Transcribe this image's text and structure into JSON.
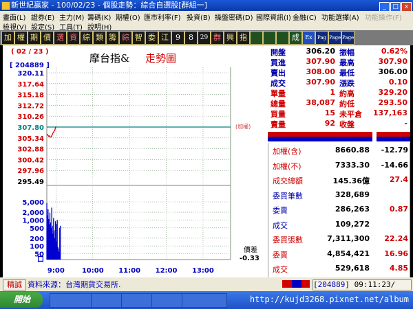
{
  "window": {
    "title": "新世紀贏家 - 100/02/23 - 個股走勢：綜合自選股[群組一]",
    "controls": [
      "_",
      "□",
      "x"
    ]
  },
  "menu": {
    "row1": [
      "畫面(L)",
      "證券(E)",
      "主力(M)",
      "籌碼(K)",
      "期權(O)",
      "匯市利率(F)",
      "投資(B)",
      "操盤密碼(D)",
      "國際資訊(I)",
      "金融(C)",
      "功能選擇(A)",
      "功能操作(F)"
    ],
    "row2": [
      "檢視(V)",
      "設定(S)",
      "工具(T)",
      "說明(H)"
    ]
  },
  "toolbar": {
    "buttons": [
      "加",
      "權",
      "期",
      "價",
      "選",
      "資",
      "綜",
      "類",
      "籌",
      "綜",
      "智",
      "委",
      "江",
      "9",
      "8",
      "29",
      "群",
      "興",
      "指",
      "",
      "",
      "",
      "成",
      "Ex",
      "Pag",
      "Page",
      "Page"
    ]
  },
  "chart": {
    "date_label": "( 02 / 23 )",
    "code_label": "[ 204889 ]",
    "title_black": "摩台指&",
    "title_red": "走勢圖",
    "ref_price": "307.80",
    "ref_price_note": "(加權)",
    "price_ticks": [
      "320.11",
      "317.64",
      "315.18",
      "312.72",
      "310.26",
      "307.80",
      "305.34",
      "302.88",
      "300.42",
      "297.96",
      "295.49"
    ],
    "volume_ticks": [
      "5,000",
      "2,000",
      "1,000",
      "500",
      "200",
      "100",
      "50",
      "口"
    ],
    "time_ticks": [
      "9:00",
      "10:00",
      "11:00",
      "12:00",
      "13:00"
    ],
    "diff_label": "價差",
    "diff_value": "-0.33",
    "colors": {
      "price_line": "#d00000",
      "ref_line": "#008080",
      "volume": "#0000d0",
      "grid": "#7a9a7a"
    }
  },
  "chart_data": {
    "type": "line",
    "x": [
      "08:45",
      "08:46",
      "08:47",
      "08:48",
      "08:49",
      "08:50",
      "08:51",
      "08:52",
      "08:53",
      "08:54",
      "08:55",
      "08:56",
      "08:57",
      "08:58",
      "08:59",
      "09:00"
    ],
    "series": [
      {
        "values": [
          306.2,
          306.1,
          305.9,
          305.7,
          305.8,
          305.6,
          305.5,
          305.6,
          305.8,
          306.1,
          306.4,
          306.6,
          306.9,
          307.0,
          307.6,
          307.9
        ]
      }
    ],
    "volume_x": [
      "08:45",
      "08:46",
      "08:47",
      "08:48",
      "08:49",
      "08:50",
      "08:51",
      "08:52",
      "08:53",
      "08:54",
      "08:55",
      "08:56",
      "08:57",
      "08:58",
      "08:59",
      "09:00",
      "09:01",
      "09:02",
      "09:03",
      "09:04",
      "09:05",
      "09:06",
      "09:07"
    ],
    "volume": [
      4500,
      1500,
      2600,
      1100,
      700,
      1900,
      800,
      500,
      3000,
      600,
      300,
      1200,
      400,
      200,
      900,
      150,
      700,
      1000,
      90,
      80,
      60,
      500,
      600
    ],
    "ylim": [
      295.49,
      320.11
    ],
    "volume_scale": "log",
    "volume_ylim": [
      50,
      5000
    ],
    "x_range": [
      "08:45",
      "13:45"
    ],
    "grid": true
  },
  "quote": {
    "rows": [
      {
        "l1": "開盤",
        "v1": "306.20",
        "l2": "振幅",
        "v2": "0.62%",
        "c1": "#000000",
        "c2": "#d00000"
      },
      {
        "l1": "買進",
        "v1": "307.90",
        "l2": "最高",
        "v2": "307.90",
        "c1": "#d00000",
        "c2": "#d00000"
      },
      {
        "l1": "賣出",
        "v1": "308.00",
        "l2": "最低",
        "v2": "306.00",
        "c1": "#d00000",
        "c2": "#000000"
      },
      {
        "l1": "成交",
        "v1": "307.90",
        "l2": "漲跌",
        "v2": "0.10",
        "c1": "#d00000",
        "c2": "#d00000"
      },
      {
        "l1": "單量",
        "v1": "1",
        "l2": "約高",
        "v2": "329.20",
        "c1": "#d00000",
        "c2": "#d00000",
        "lc1": "red",
        "lc2": "red"
      },
      {
        "l1": "總量",
        "v1": "38,087",
        "l2": "約低",
        "v2": "293.50",
        "c1": "#d00000",
        "c2": "#d00000",
        "lc1": "red",
        "lc2": "red"
      },
      {
        "l1": "買量",
        "v1": "15",
        "l2": "未平倉",
        "v2": "137,163",
        "c1": "#d00000",
        "c2": "#d00000",
        "lc1": "red",
        "lc2": "red"
      },
      {
        "l1": "賣量",
        "v1": "92",
        "l2": "收盤",
        "v2": "-",
        "c1": "#d00000",
        "c2": "#d00000",
        "lc1": "red",
        "lc2": "red"
      }
    ]
  },
  "index_info": {
    "rows": [
      {
        "label": "加權(含)",
        "v1": "8660.88",
        "v2": "-12.79",
        "lc": "#d00000",
        "c2": "#000000"
      },
      {
        "label": "加權(不)",
        "v1": "7333.30",
        "v2": "-14.66",
        "lc": "#d00000",
        "c2": "#000000"
      },
      {
        "label": "成交總額",
        "v1": "145.36億",
        "v2": "27.4",
        "lc": "#d00000",
        "c2": "#d00000"
      },
      {
        "label": "委買筆數",
        "v1": "328,689",
        "v2": "",
        "lc": "#0000b0",
        "c2": "#000000"
      },
      {
        "label": "委賣",
        "v1": "286,263",
        "v2": "0.87",
        "lc": "#0000b0",
        "c2": "#d00000"
      },
      {
        "label": "成交",
        "v1": "109,272",
        "v2": "",
        "lc": "#0000b0",
        "c2": "#000000"
      },
      {
        "label": "委買張數",
        "v1": "7,311,300",
        "v2": "22.24",
        "lc": "#d00000",
        "c2": "#d00000"
      },
      {
        "label": "委賣",
        "v1": "4,854,421",
        "v2": "16.96",
        "lc": "#d00000",
        "c2": "#d00000"
      },
      {
        "label": "成交",
        "v1": "529,618",
        "v2": "4.85",
        "lc": "#d00000",
        "c2": "#d00000"
      }
    ]
  },
  "status": {
    "tag": "精誠",
    "source": "資料來源：台灣期貨交易所.",
    "code": "204889",
    "time": "09:11:23"
  },
  "taskbar": {
    "start": "開始",
    "url": "http://kujd3268.pixnet.net/album"
  }
}
